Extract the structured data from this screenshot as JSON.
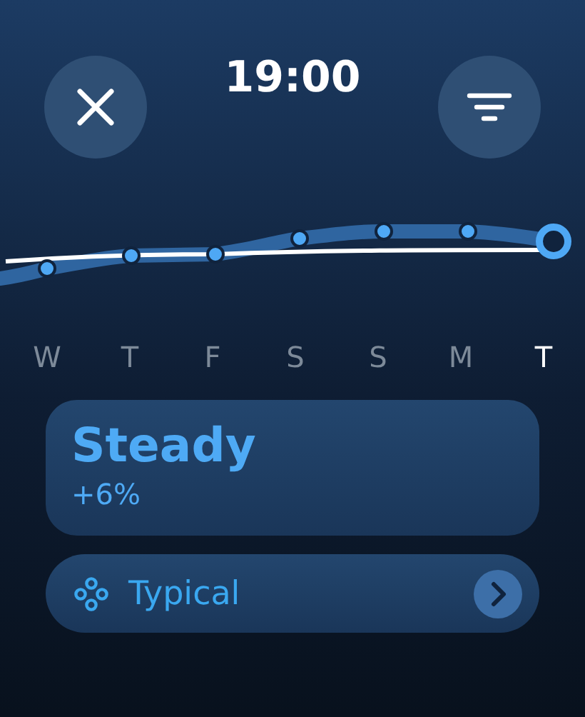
{
  "time": "19:00",
  "days": [
    {
      "label": "W",
      "selected": false
    },
    {
      "label": "T",
      "selected": false
    },
    {
      "label": "F",
      "selected": false
    },
    {
      "label": "S",
      "selected": false
    },
    {
      "label": "S",
      "selected": false
    },
    {
      "label": "M",
      "selected": false
    },
    {
      "label": "T",
      "selected": true
    }
  ],
  "trend": {
    "title": "Steady",
    "change": "+6%"
  },
  "category": {
    "label": "Typical"
  }
}
